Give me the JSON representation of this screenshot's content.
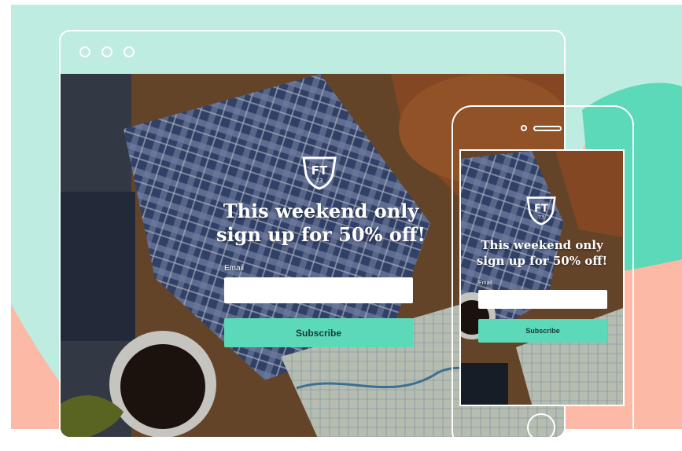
{
  "brand": {
    "logo_text": "FT",
    "logo_subtext": "73"
  },
  "desktop": {
    "headline_line1": "This weekend only",
    "headline_line2": "sign up for 50% off!",
    "email_label": "Email",
    "email_value": "",
    "subscribe_label": "Subscribe"
  },
  "mobile": {
    "headline_line1": "This weekend only",
    "headline_line2": "sign up for 50% off!",
    "email_label": "Email",
    "email_value": "",
    "subscribe_label": "Subscribe"
  },
  "colors": {
    "mint_background": "#bfece0",
    "teal_accent": "#5bd9b9",
    "coral_background": "#fbb9a6",
    "frame_outline": "#ffffff"
  }
}
